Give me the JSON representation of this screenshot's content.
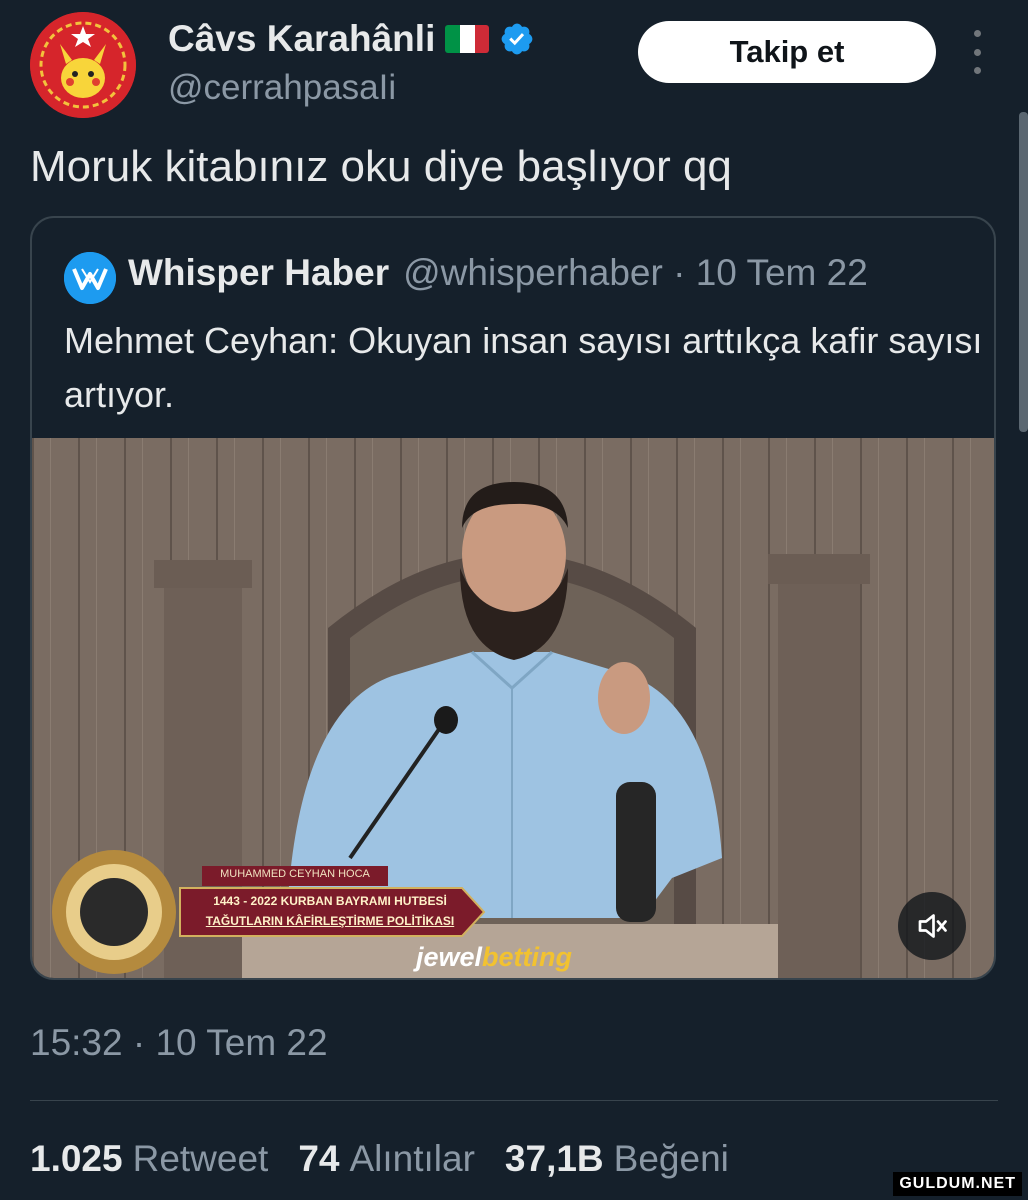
{
  "author": {
    "display_name": "Câvs Karahânli",
    "handle": "@cerrahpasaIi",
    "flag_colors": [
      "#009246",
      "#ffffff",
      "#ce2b37"
    ],
    "verified_color": "#1d9bf0"
  },
  "follow_label": "Takip et",
  "tweet_text": "Moruk kitabınız oku diye başlıyor qq",
  "quote": {
    "name": "Whisper Haber",
    "meta": "@whisperhaber · 10 Tem 22",
    "text": "Mehmet Ceyhan: Okuyan insan sayısı arttıkça kafir sayısı artıyor.",
    "video": {
      "speaker_caption": "MUHAMMED CEYHAN HOCA",
      "banner_line1": "1443 - 2022 KURBAN BAYRAMI HUTBESİ",
      "banner_line2": "TAĞUTLARIN KÂFİRLEŞTİRME POLİTİKASI",
      "sponsor_part1": "jewel",
      "sponsor_part2": "betting",
      "muted": true
    }
  },
  "timestamp": "15:32 · 10 Tem 22",
  "stats": [
    {
      "value": "1.025",
      "label": "Retweet"
    },
    {
      "value": "74",
      "label": "Alıntılar"
    },
    {
      "value": "37,1B",
      "label": "Beğeni"
    }
  ],
  "watermark": "GULDUM.NET"
}
